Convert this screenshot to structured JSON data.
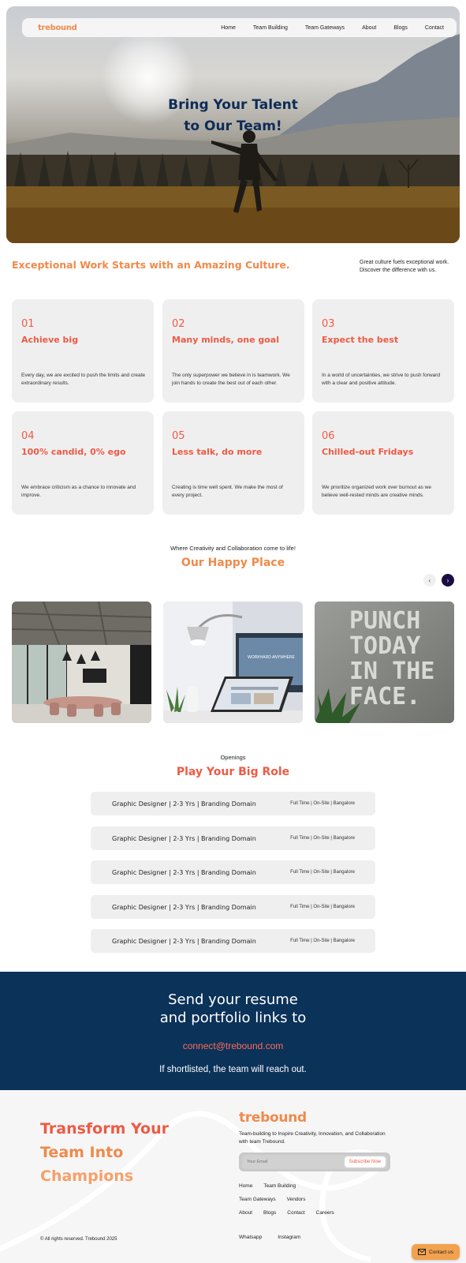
{
  "nav": {
    "logo": "trebound",
    "links": [
      "Home",
      "Team Building",
      "Team Gateways",
      "About",
      "Blogs",
      "Contact"
    ]
  },
  "hero": {
    "title_line1": "Bring Your Talent",
    "title_line2": "to Our Team!"
  },
  "culture": {
    "heading": "Exceptional Work Starts with an Amazing Culture.",
    "side_text": "Great culture fuels exceptional work. Discover the difference with us."
  },
  "values": [
    {
      "num": "01",
      "title": "Achieve big",
      "desc": "Every day, we are excited to push the limits and create extraordinary results."
    },
    {
      "num": "02",
      "title": "Many minds, one goal",
      "desc": "The only superpower we believe in is teamwork. We join hands to create the best out of each other."
    },
    {
      "num": "03",
      "title": "Expect the best",
      "desc": "In a world of uncertainties, we strive to push forward with a clear and positive attitude."
    },
    {
      "num": "04",
      "title": "100% candid, 0% ego",
      "desc": "We embrace criticism as a chance to innovate and improve."
    },
    {
      "num": "05",
      "title": "Less talk, do more",
      "desc": "Creating is time well spent. We make the most of every project."
    },
    {
      "num": "06",
      "title": "Chilled-out Fridays",
      "desc": "We prioritize organized work over burnout as we believe well-rested minds are creative minds."
    }
  ],
  "happy_place": {
    "subtitle": "Where Creativity and Collaboration come to life!",
    "title": "Our Happy Place",
    "poster_text": "PUNCH TODAY IN THE FACE.",
    "poster_lines": [
      "PUNCH",
      "TODAY",
      "IN THE",
      "FACE."
    ],
    "screen_text": "WORKHARD ANYWHERE"
  },
  "openings": {
    "subtitle": "Openings",
    "title": "Play Your Big Role",
    "jobs": [
      {
        "title": "Graphic Designer | 2-3 Yrs | Branding Domain",
        "meta": "Full Time | On-Site | Bangalore"
      },
      {
        "title": "Graphic Designer | 2-3 Yrs | Branding Domain",
        "meta": "Full Time | On-Site | Bangalore"
      },
      {
        "title": "Graphic Designer | 2-3 Yrs | Branding Domain",
        "meta": "Full Time | On-Site | Bangalore"
      },
      {
        "title": "Graphic Designer | 2-3 Yrs | Branding Domain",
        "meta": "Full Time | On-Site | Bangalore"
      },
      {
        "title": "Graphic Designer | 2-3 Yrs | Branding Domain",
        "meta": "Full Time | On-Site | Bangalore"
      }
    ]
  },
  "resume": {
    "line1": "Send your resume",
    "line2": "and portfolio links to",
    "email": "connect@trebound.com",
    "note": "If shortlisted, the team will reach out."
  },
  "footer": {
    "title_line1": "Transform Your",
    "title_line2": "Team Into",
    "title_line3": "Champions",
    "logo": "trebound",
    "tagline": "Team-building to Inspire Creativity, Innovation, and Collaboration with team Trebound.",
    "email_placeholder": "Your Email",
    "subscribe_label": "Subscribe Now",
    "links_row1": [
      "Home",
      "Team Building"
    ],
    "links_row2": [
      "Team Gateways",
      "Vendors"
    ],
    "links_row3": [
      "About",
      "Blogs",
      "Contact",
      "Careers"
    ],
    "social": [
      "Whatsapp",
      "Instagram"
    ],
    "copyright": "© All rights reserved. Trebound 2025"
  },
  "contact_button": {
    "label": "Contact us",
    "icon": "mail-icon"
  },
  "colors": {
    "accent_orange": "#f08a4b",
    "accent_red": "#ee5a44",
    "navy": "#0b3259",
    "card_bg": "#efefef"
  }
}
